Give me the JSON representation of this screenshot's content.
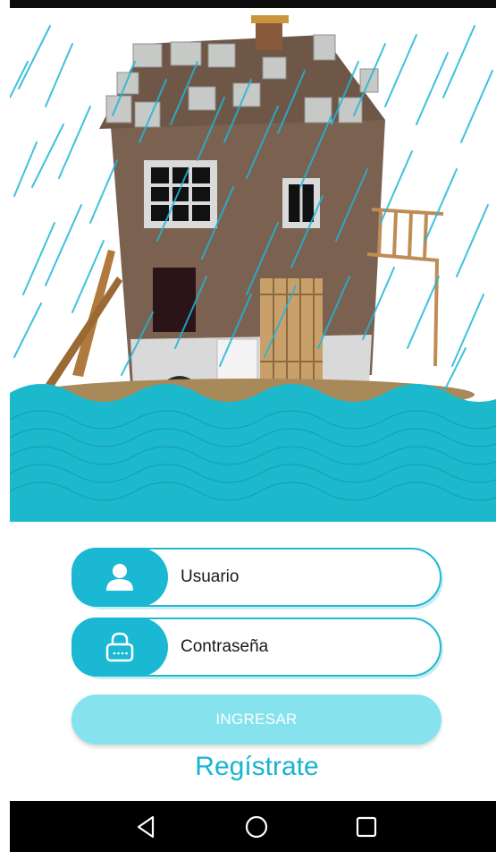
{
  "hero": {
    "illustration": "flooded-house-in-rain"
  },
  "login": {
    "username_placeholder": "Usuario",
    "password_placeholder": "Contraseña",
    "submit_label": "INGRESAR",
    "register_label": "Regístrate",
    "user_icon": "user-icon",
    "lock_icon": "lock-icon"
  },
  "navbar": {
    "back_icon": "back-triangle-icon",
    "home_icon": "home-circle-icon",
    "recents_icon": "recents-square-icon"
  },
  "colors": {
    "accent": "#1ab8d2",
    "button_disabled": "#86e3ee",
    "water": "#1cb8cc",
    "navbar": "#000000"
  }
}
